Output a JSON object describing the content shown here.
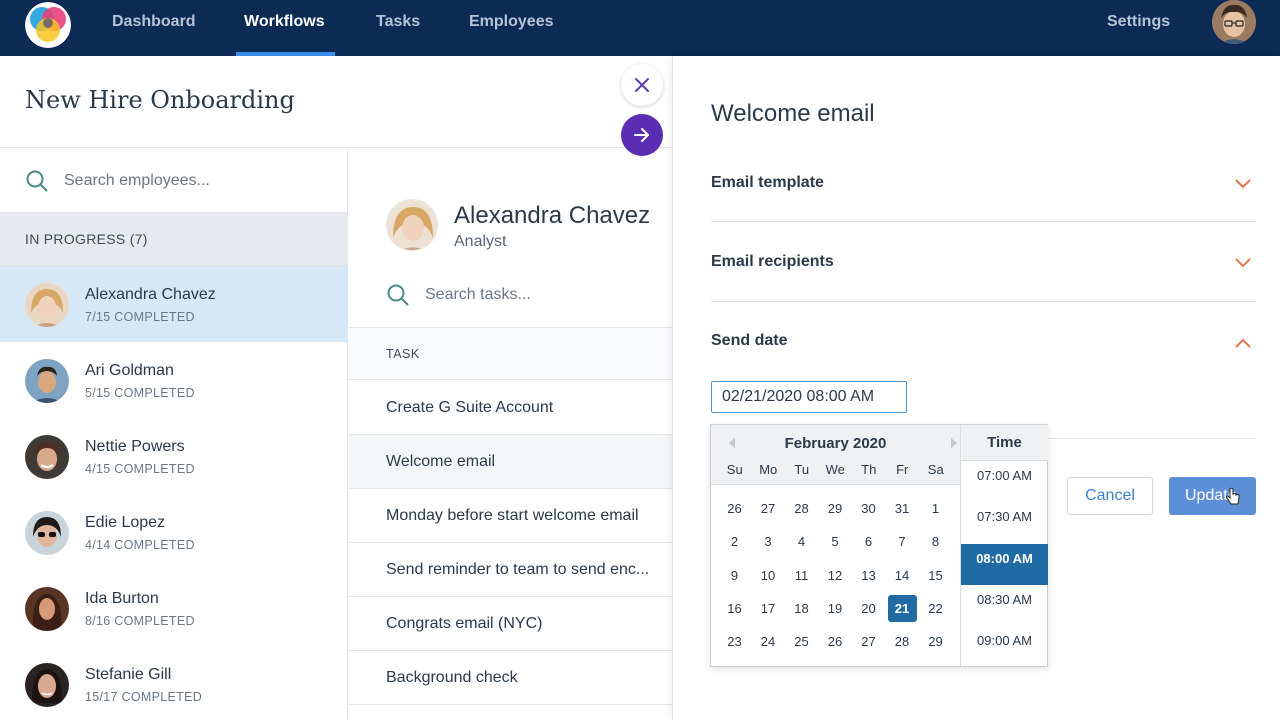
{
  "nav": {
    "items": [
      {
        "label": "Dashboard",
        "active": false
      },
      {
        "label": "Workflows",
        "active": true
      },
      {
        "label": "Tasks",
        "active": false
      },
      {
        "label": "Employees",
        "active": false
      }
    ],
    "settings_label": "Settings",
    "colors": {
      "bar": "#0b2a54",
      "underline": "#3c8be6"
    }
  },
  "workflow": {
    "title": "New Hire Onboarding"
  },
  "employees": {
    "search_placeholder": "Search employees...",
    "group_header": "IN PROGRESS (7)",
    "items": [
      {
        "name": "Alexandra Chavez",
        "progress": "7/15 COMPLETED",
        "selected": true
      },
      {
        "name": "Ari Goldman",
        "progress": "5/15 COMPLETED",
        "selected": false
      },
      {
        "name": "Nettie Powers",
        "progress": "4/15 COMPLETED",
        "selected": false
      },
      {
        "name": "Edie Lopez",
        "progress": "4/14 COMPLETED",
        "selected": false
      },
      {
        "name": "Ida Burton",
        "progress": "8/16 COMPLETED",
        "selected": false
      },
      {
        "name": "Stefanie Gill",
        "progress": "15/17 COMPLETED",
        "selected": false
      }
    ]
  },
  "tasks": {
    "person_name": "Alexandra Chavez",
    "person_role": "Analyst",
    "search_placeholder": "Search tasks...",
    "column_header": "TASK",
    "items": [
      "Create G Suite Account",
      "Welcome email",
      "Monday before start welcome email",
      "Send reminder to team to send enc...",
      "Congrats email (NYC)",
      "Background check"
    ]
  },
  "panel": {
    "title": "Welcome email",
    "sections": [
      {
        "label": "Email template",
        "expanded": false
      },
      {
        "label": "Email recipients",
        "expanded": false
      },
      {
        "label": "Send date",
        "expanded": true
      }
    ],
    "date_value": "02/21/2020 08:00 AM",
    "cancel_label": "Cancel",
    "update_label": "Update",
    "accent": "#e8734f"
  },
  "datepicker": {
    "month": "February 2020",
    "weekdays": [
      "Su",
      "Mo",
      "Tu",
      "We",
      "Th",
      "Fr",
      "Sa"
    ],
    "weeks": [
      [
        "26",
        "27",
        "28",
        "29",
        "30",
        "31",
        "1"
      ],
      [
        "2",
        "3",
        "4",
        "5",
        "6",
        "7",
        "8"
      ],
      [
        "9",
        "10",
        "11",
        "12",
        "13",
        "14",
        "15"
      ],
      [
        "16",
        "17",
        "18",
        "19",
        "20",
        "21",
        "22"
      ],
      [
        "23",
        "24",
        "25",
        "26",
        "27",
        "28",
        "29"
      ]
    ],
    "selected_day": "21",
    "time_header": "Time",
    "times": [
      "07:00 AM",
      "07:30 AM",
      "08:00 AM",
      "08:30 AM",
      "09:00 AM"
    ],
    "selected_time": "08:00 AM",
    "selected_color": "#216ba5"
  }
}
